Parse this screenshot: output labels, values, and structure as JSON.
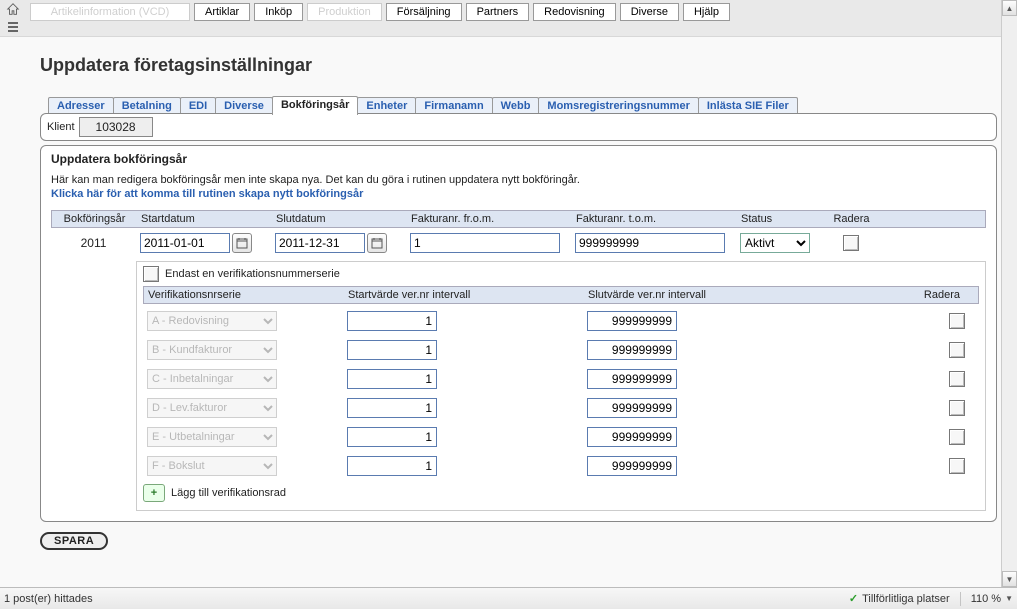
{
  "topmenu": {
    "artikelinfo": "Artikelinformation (VCD)",
    "artiklar": "Artiklar",
    "inkop": "Inköp",
    "produktion": "Produktion",
    "forsaljning": "Försäljning",
    "partners": "Partners",
    "redovisning": "Redovisning",
    "diverse": "Diverse",
    "hjalp": "Hjälp"
  },
  "page_title": "Uppdatera företagsinställningar",
  "tabs": {
    "adresser": "Adresser",
    "betalning": "Betalning",
    "edi": "EDI",
    "diverse": "Diverse",
    "bokforingsar": "Bokföringsår",
    "enheter": "Enheter",
    "firmanamn": "Firmanamn",
    "webb": "Webb",
    "momsreg": "Momsregistreringsnummer",
    "sie": "Inlästa SIE Filer"
  },
  "klient_label": "Klient",
  "klient_value": "103028",
  "section_title": "Uppdatera bokföringsår",
  "help_line": "Här kan man redigera bokföringsår men inte skapa nya. Det kan du göra i rutinen uppdatera nytt bokföringår.",
  "help_link": "Klicka här för att komma till rutinen skapa nytt bokföringsår",
  "cols": {
    "year": "Bokföringsår",
    "start": "Startdatum",
    "end": "Slutdatum",
    "invfrom": "Fakturanr. fr.o.m.",
    "invto": "Fakturanr. t.o.m.",
    "status": "Status",
    "del": "Radera"
  },
  "row": {
    "year": "2011",
    "start": "2011-01-01",
    "end": "2011-12-31",
    "invfrom": "1",
    "invto": "999999999",
    "status": "Aktivt"
  },
  "only_one_label": "Endast en verifikationsnummerserie",
  "subcols": {
    "serie": "Verifikationsnrserie",
    "start": "Startvärde ver.nr intervall",
    "end": "Slutvärde ver.nr intervall",
    "del": "Radera"
  },
  "series": [
    {
      "name": "A - Redovisning",
      "start": "1",
      "end": "999999999"
    },
    {
      "name": "B - Kundfakturor",
      "start": "1",
      "end": "999999999"
    },
    {
      "name": "C - Inbetalningar",
      "start": "1",
      "end": "999999999"
    },
    {
      "name": "D - Lev.fakturor",
      "start": "1",
      "end": "999999999"
    },
    {
      "name": "E - Utbetalningar",
      "start": "1",
      "end": "999999999"
    },
    {
      "name": "F - Bokslut",
      "start": "1",
      "end": "999999999"
    }
  ],
  "add_row_label": "Lägg till verifikationsrad",
  "save_label": "SPARA",
  "status": {
    "left": "1 post(er) hittades",
    "trusted": "Tillförlitliga platser",
    "zoom": "110 %"
  }
}
